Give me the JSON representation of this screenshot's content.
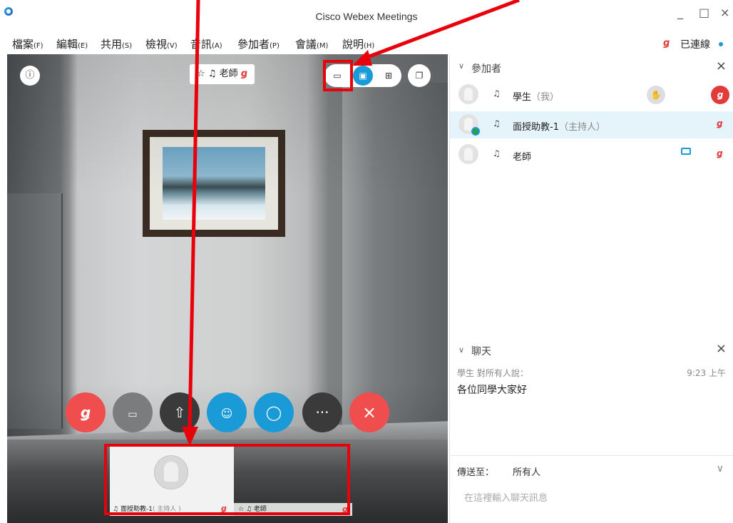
{
  "window": {
    "title": "Cisco Webex Meetings",
    "minimize": "_",
    "maximize": "□",
    "close": "×"
  },
  "menu": [
    {
      "label": "檔案",
      "key": "(F)"
    },
    {
      "label": "編輯",
      "key": "(E)"
    },
    {
      "label": "共用",
      "key": "(S)"
    },
    {
      "label": "檢視",
      "key": "(V)"
    },
    {
      "label": "音訊",
      "key": "(A)"
    },
    {
      "label": "參加者",
      "key": "(P)"
    },
    {
      "label": "會議",
      "key": "(M)"
    },
    {
      "label": "說明",
      "key": "(H)"
    }
  ],
  "connection": {
    "status": "已連線"
  },
  "video": {
    "active_speaker": "老師",
    "self_thumb_name": "面授助教-1",
    "self_thumb_role": "( 主持人 )",
    "other_thumb_name": "老師"
  },
  "participants_panel": {
    "title": "參加者",
    "rows": [
      {
        "name": "學生",
        "role": "（我）"
      },
      {
        "name": "面授助教-1",
        "role": "（主持人）"
      },
      {
        "name": "老師",
        "role": ""
      }
    ]
  },
  "chat_panel": {
    "title": "聊天",
    "meta": "學生 對所有人說：",
    "time": "9:23 上午",
    "message": "各位同學大家好",
    "send_to_label": "傳送至：",
    "send_to_value": "所有人",
    "input_placeholder": "在這裡輸入聊天訊息"
  },
  "icons": {
    "info": "info-icon",
    "layout_thumb": "thumbnail-layout-icon",
    "layout_strip": "filmstrip-layout-icon",
    "layout_grid": "grid-layout-icon",
    "popout": "popout-icon",
    "mute": "microphone-muted-icon",
    "video": "video-icon",
    "share": "share-icon",
    "participants": "participants-icon",
    "chat": "chat-icon",
    "more": "more-icon",
    "leave": "leave-icon"
  },
  "colors": {
    "accent": "#1a9bd7",
    "danger": "#f04e4e",
    "annotation": "#e8000b"
  }
}
